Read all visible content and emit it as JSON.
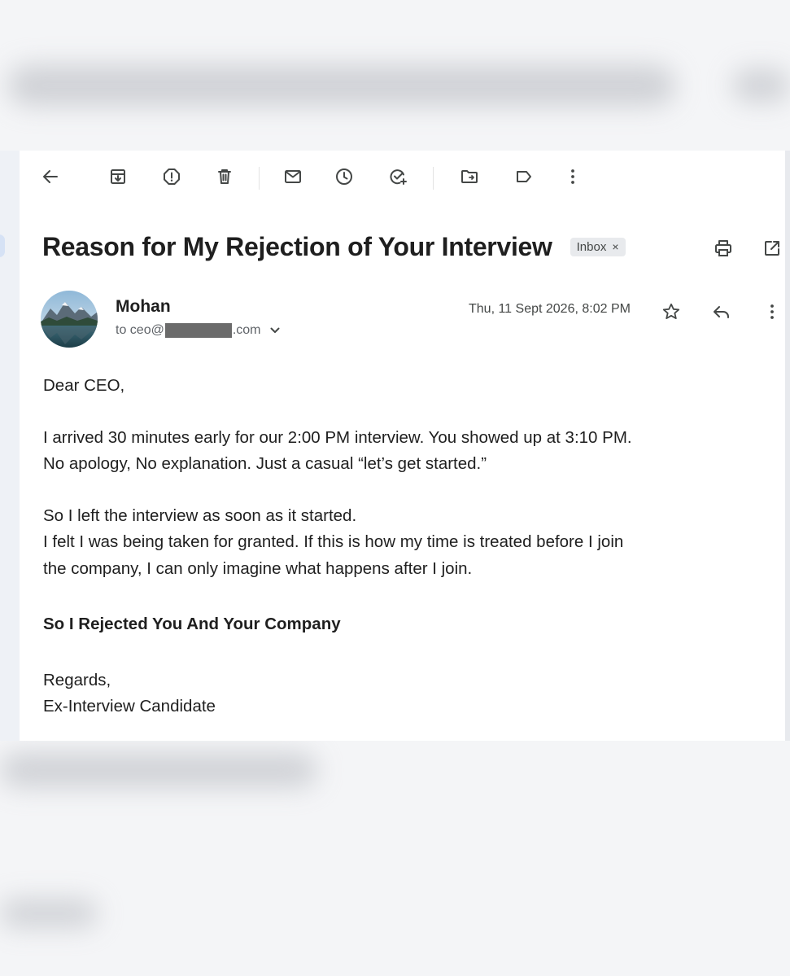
{
  "toolbar": {
    "icons": [
      "back-arrow-icon",
      "archive-icon",
      "report-spam-icon",
      "delete-icon",
      "mark-unread-icon",
      "snooze-icon",
      "add-task-icon",
      "move-to-icon",
      "label-icon",
      "more-vert-icon"
    ]
  },
  "email": {
    "subject": "Reason for My Rejection of Your Interview",
    "label": "Inbox",
    "label_remove": "×",
    "sender": "Mohan",
    "to_prefix": "to ceo@",
    "to_suffix": ".com",
    "date": "Thu, 11 Sept 2026, 8:02 PM",
    "body": {
      "greeting": "Dear CEO,",
      "p1_l1": "I arrived 30 minutes early for our 2:00 PM interview. You showed up at 3:10 PM.",
      "p1_l2": "No apology, No explanation. Just a casual “let’s get started.”",
      "p2_l1": "So I left the interview as soon as it started.",
      "p2_l2": "I felt I was being taken for granted. If this is how my time is treated before I join",
      "p2_l3": "the company, I can only imagine what happens after I join.",
      "emphasis": "So I Rejected You And Your Company",
      "signoff": "Regards,",
      "signature": "Ex-Interview Candidate"
    }
  },
  "colors": {
    "icon": "#444746",
    "text": "#1f1f1f",
    "chip_bg": "#e8eaed",
    "redaction": "#6b6b6b"
  }
}
